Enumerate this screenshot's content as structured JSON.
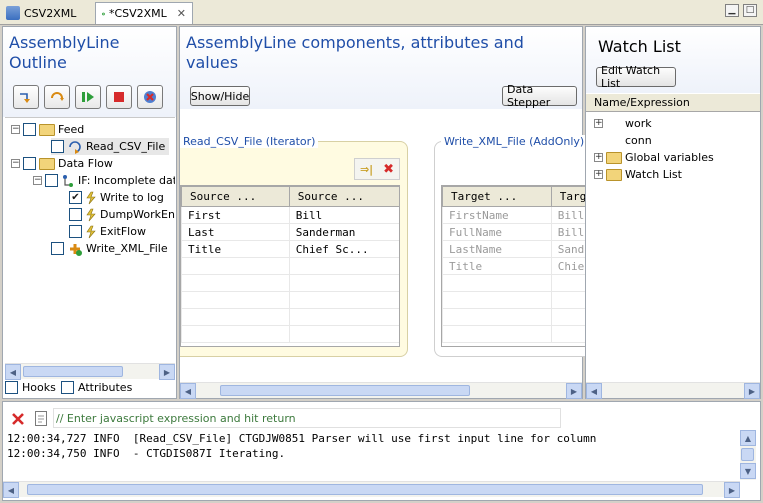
{
  "tabs": [
    {
      "label": "CSV2XML",
      "active": false
    },
    {
      "label": "*CSV2XML",
      "active": true
    }
  ],
  "outline": {
    "title": "AssemblyLine Outline",
    "tree": {
      "feed": "Feed",
      "read_csv": "Read_CSV_File",
      "data_flow": "Data Flow",
      "if_node": "IF: Incomplete data",
      "write_to_log": "Write to log",
      "dump_work": "DumpWorkEntr",
      "exit_flow": "ExitFlow",
      "write_xml": "Write_XML_File"
    },
    "hooks_label": "Hooks",
    "attributes_label": "Attributes"
  },
  "components": {
    "title": "AssemblyLine components, attributes and values",
    "show_hide_label": "Show/Hide",
    "data_stepper_label": "Data Stepper",
    "read_box": {
      "title": "Read_CSV_File (Iterator)",
      "columns": [
        "Source ...",
        "Source ..."
      ],
      "rows": [
        [
          "First",
          "Bill"
        ],
        [
          "Last",
          "Sanderman"
        ],
        [
          "Title",
          "Chief Sc..."
        ]
      ]
    },
    "write_box": {
      "title": "Write_XML_File (AddOnly)",
      "columns": [
        "Target ...",
        "Targ"
      ],
      "rows": [
        [
          "FirstName",
          "Bill"
        ],
        [
          "FullName",
          "Bill"
        ],
        [
          "LastName",
          "Sande"
        ],
        [
          "Title",
          "Chie"
        ]
      ]
    }
  },
  "watch": {
    "title": "Watch List",
    "edit_label": "Edit Watch List",
    "column_header": "Name/Expression",
    "items": [
      "work",
      "conn",
      "Global variables",
      "Watch List"
    ]
  },
  "console": {
    "input_placeholder": "// Enter javascript expression and hit return",
    "line1": "12:00:34,727 INFO  [Read_CSV_File] CTGDJW0851 Parser will use first input line for column",
    "line2": "12:00:34,750 INFO  - CTGDIS087I Iterating."
  }
}
